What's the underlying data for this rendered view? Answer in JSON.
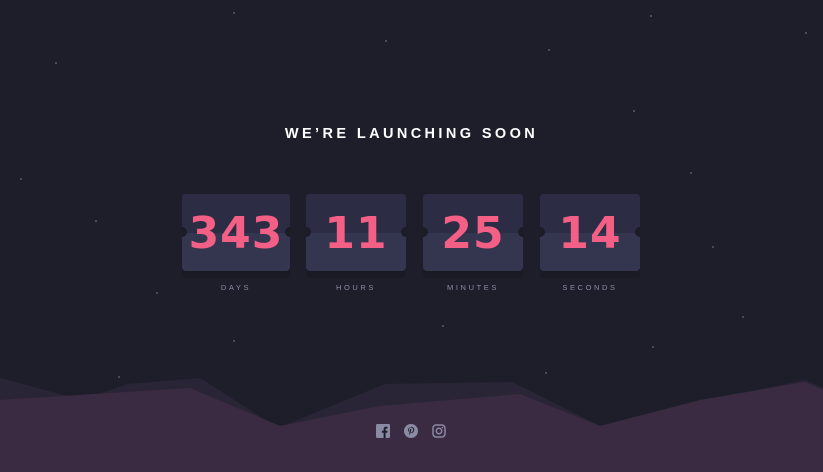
{
  "headline": "WE’RE LAUNCHING SOON",
  "countdown": [
    {
      "value": "343",
      "label": "DAYS"
    },
    {
      "value": "11",
      "label": "HOURS"
    },
    {
      "value": "25",
      "label": "MINUTES"
    },
    {
      "value": "14",
      "label": "SECONDS"
    }
  ],
  "social": [
    "facebook-icon",
    "pinterest-icon",
    "instagram-icon"
  ],
  "colors": {
    "background": "#1e1e2a",
    "card": "#343650",
    "digits": "#f45f85",
    "label": "#8a8aa5",
    "hills": "#3a2b42"
  }
}
